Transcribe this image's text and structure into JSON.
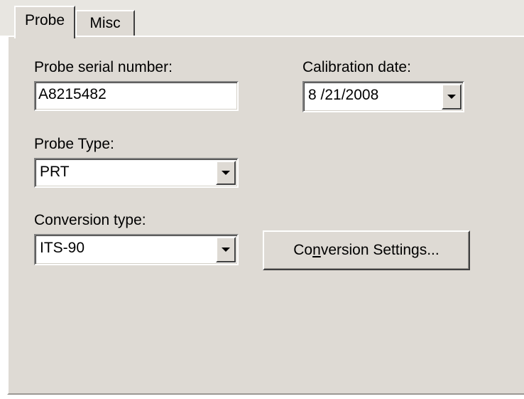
{
  "tabs": [
    {
      "label": "Probe",
      "active": true
    },
    {
      "label": "Misc",
      "active": false
    }
  ],
  "probe": {
    "serial_label": "Probe serial number:",
    "serial_value": "A8215482",
    "calibration_label": "Calibration date:",
    "calibration_value": "8 /21/2008",
    "type_label": "Probe Type:",
    "type_value": "PRT",
    "conversion_label": "Conversion type:",
    "conversion_value": "ITS-90",
    "settings_button": {
      "before": "Co",
      "mnemonic": "n",
      "after": "version Settings..."
    }
  },
  "colors": {
    "face": "#dedad4",
    "background": "#e8e6e1",
    "field": "#ffffff",
    "text": "#000000"
  },
  "icons": {
    "dropdown": "chevron-down-icon"
  }
}
